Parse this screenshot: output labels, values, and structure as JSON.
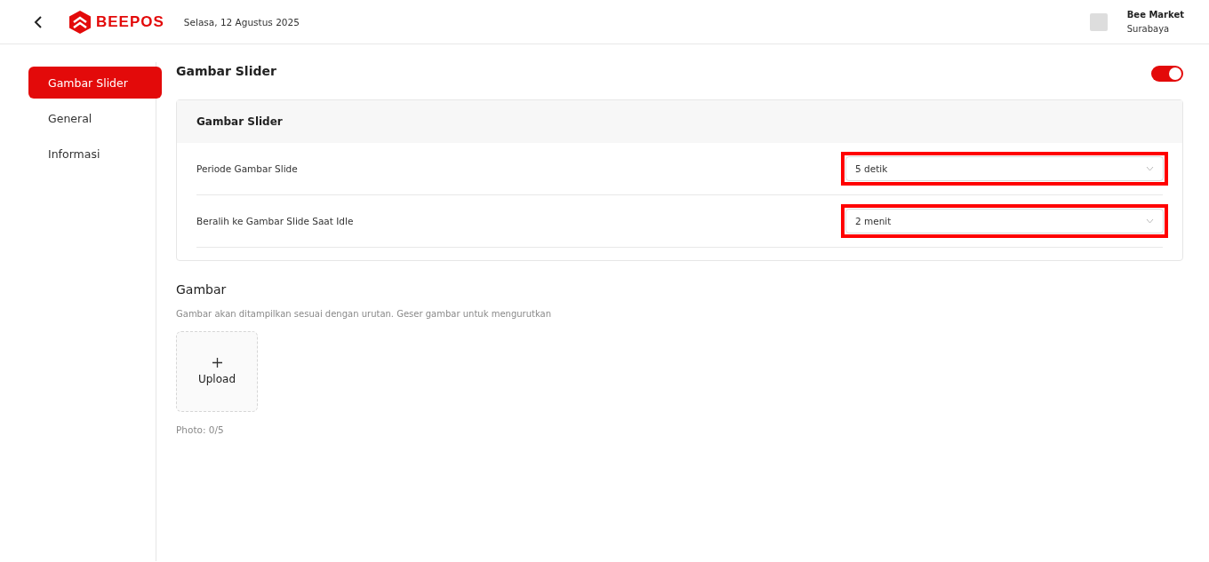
{
  "header": {
    "logo_text": "BEEPOS",
    "date": "Selasa, 12 Agustus 2025",
    "store_name": "Bee Market",
    "store_city": "Surabaya"
  },
  "sidebar": {
    "items": [
      {
        "label": "Gambar Slider",
        "selected": true
      },
      {
        "label": "General",
        "selected": false
      },
      {
        "label": "Informasi",
        "selected": false
      }
    ]
  },
  "section": {
    "title": "Gambar Slider",
    "enabled": true
  },
  "settings_card": {
    "title": "Gambar Slider",
    "rows": [
      {
        "label": "Periode Gambar Slide",
        "value": "5 detik",
        "highlighted": true
      },
      {
        "label": "Beralih ke Gambar Slide Saat Idle",
        "value": "2 menit",
        "highlighted": true
      }
    ]
  },
  "images": {
    "title": "Gambar",
    "hint": "Gambar akan ditampilkan sesuai dengan urutan. Geser gambar untuk mengurutkan",
    "upload_label": "Upload",
    "count": "Photo: 0/5"
  }
}
